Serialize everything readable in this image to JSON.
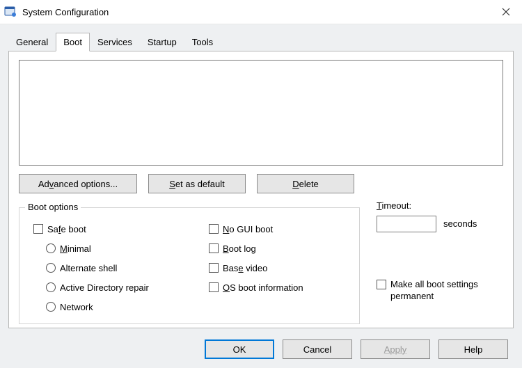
{
  "window": {
    "title": "System Configuration"
  },
  "tabs": {
    "general": "General",
    "boot": "Boot",
    "services": "Services",
    "startup": "Startup",
    "tools": "Tools"
  },
  "buttons": {
    "advanced_pre": "Ad",
    "advanced_ak": "v",
    "advanced_post": "anced options...",
    "setdefault_ak": "S",
    "setdefault_post": "et as default",
    "delete_ak": "D",
    "delete_post": "elete"
  },
  "group": {
    "boot_options": "Boot options"
  },
  "bootopts": {
    "safeboot_pre": "Sa",
    "safeboot_ak": "f",
    "safeboot_post": "e boot",
    "minimal_ak": "M",
    "minimal_post": "inimal",
    "altshell_ak": "",
    "altshell_post": "Alternate shell",
    "adrepair": "Active Directory repair",
    "network": "Network",
    "nogui_ak": "N",
    "nogui_post": "o GUI boot",
    "bootlog_ak": "B",
    "bootlog_post": "oot log",
    "basevideo_pre": "Bas",
    "basevideo_ak": "e",
    "basevideo_post": " video",
    "osboot_ak": "O",
    "osboot_post": "S boot information"
  },
  "timeout": {
    "label_ak": "T",
    "label_post": "imeout:",
    "value": "",
    "unit": "seconds"
  },
  "permanent": {
    "label": "Make all boot settings permanent"
  },
  "dialog_buttons": {
    "ok": "OK",
    "cancel": "Cancel",
    "apply_ak": "A",
    "apply_post": "pply",
    "help": "Help"
  }
}
